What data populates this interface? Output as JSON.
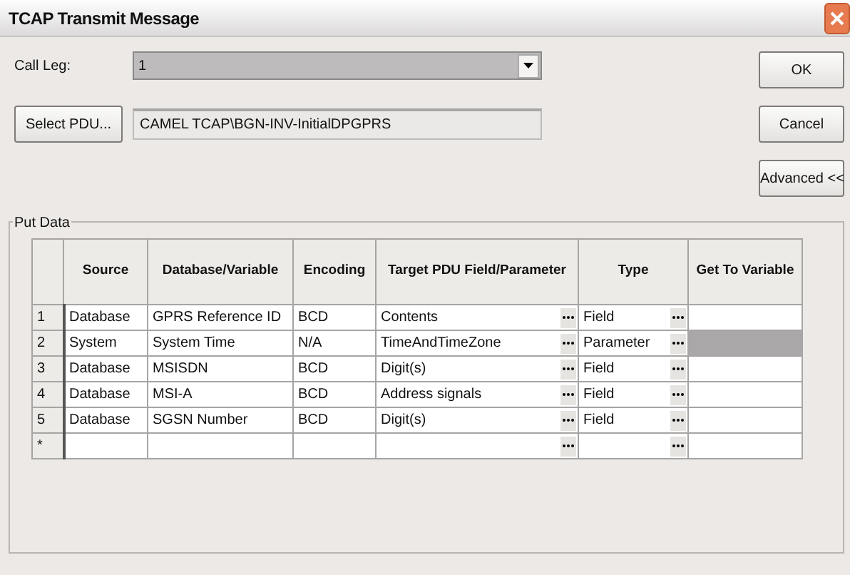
{
  "window": {
    "title": "TCAP Transmit Message"
  },
  "call_leg": {
    "label": "Call Leg:",
    "value": "1"
  },
  "select_pdu": {
    "button": "Select PDU...",
    "value": "CAMEL TCAP\\BGN-INV-InitialDPGPRS"
  },
  "buttons": [
    "OK",
    "Cancel",
    "Advanced <<"
  ],
  "put_data": {
    "title": "Put Data",
    "columns": [
      "Source",
      "Database/Variable",
      "Encoding",
      "Target PDU Field/Parameter",
      "Type",
      "Get To Variable"
    ],
    "rows": [
      {
        "number": "1",
        "source": "Database",
        "variable": "GPRS Reference ID",
        "encoding": "BCD",
        "target": "Contents",
        "type": "Field",
        "get_disabled": false
      },
      {
        "number": "2",
        "source": "System",
        "variable": "System Time",
        "encoding": "N/A",
        "target": "TimeAndTimeZone",
        "type": "Parameter",
        "get_disabled": true
      },
      {
        "number": "3",
        "source": "Database",
        "variable": "MSISDN",
        "encoding": "BCD",
        "target": "Digit(s)",
        "type": "Field",
        "get_disabled": false
      },
      {
        "number": "4",
        "source": "Database",
        "variable": "MSI-A",
        "encoding": "BCD",
        "target": "Address signals",
        "type": "Field",
        "get_disabled": false
      },
      {
        "number": "5",
        "source": "Database",
        "variable": "SGSN Number",
        "encoding": "BCD",
        "target": "Digit(s)",
        "type": "Field",
        "get_disabled": false
      }
    ],
    "new_row": {
      "marker": "*"
    }
  }
}
